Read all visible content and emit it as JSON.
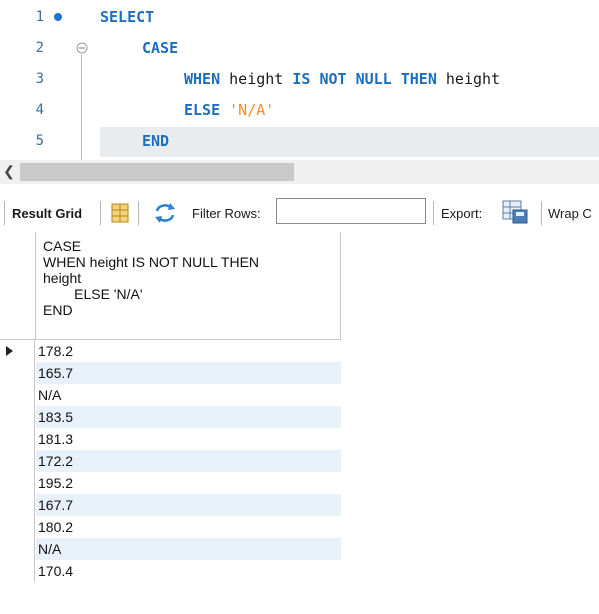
{
  "editor": {
    "lines": [
      {
        "num": "1",
        "indent": 0,
        "tokens": [
          {
            "t": "SELECT",
            "k": "kw"
          }
        ]
      },
      {
        "num": "2",
        "indent": 1,
        "tokens": [
          {
            "t": "CASE",
            "k": "kw"
          }
        ]
      },
      {
        "num": "3",
        "indent": 2,
        "tokens": [
          {
            "t": "WHEN",
            "k": "kw"
          },
          {
            "t": " height ",
            "k": ""
          },
          {
            "t": "IS NOT NULL THEN",
            "k": "kw"
          },
          {
            "t": " height",
            "k": ""
          }
        ]
      },
      {
        "num": "4",
        "indent": 2,
        "tokens": [
          {
            "t": "ELSE",
            "k": "kw"
          },
          {
            "t": " ",
            "k": ""
          },
          {
            "t": "'N/A'",
            "k": "str"
          }
        ]
      },
      {
        "num": "5",
        "indent": 1,
        "tokens": [
          {
            "t": "END",
            "k": "kw"
          }
        ]
      }
    ],
    "current_line": "5",
    "marker_line": "1",
    "fold_line": "2"
  },
  "toolbar": {
    "result_grid_label": "Result Grid",
    "filter_rows_label": "Filter Rows:",
    "filter_value": "",
    "export_label": "Export:",
    "wrap_label": "Wrap C"
  },
  "grid": {
    "column_header": "CASE\nWHEN height IS NOT NULL THEN\nheight\n        ELSE 'N/A'\nEND",
    "selected_row": 0,
    "rows": [
      "178.2",
      "165.7",
      "N/A",
      "183.5",
      "181.3",
      "172.2",
      "195.2",
      "167.7",
      "180.2",
      "N/A",
      "170.4"
    ]
  },
  "colors": {
    "keyword": "#1c6fbf",
    "string": "#f58d2a",
    "line_number": "#3c6e9e",
    "alt_row": "#e8f0fa"
  }
}
